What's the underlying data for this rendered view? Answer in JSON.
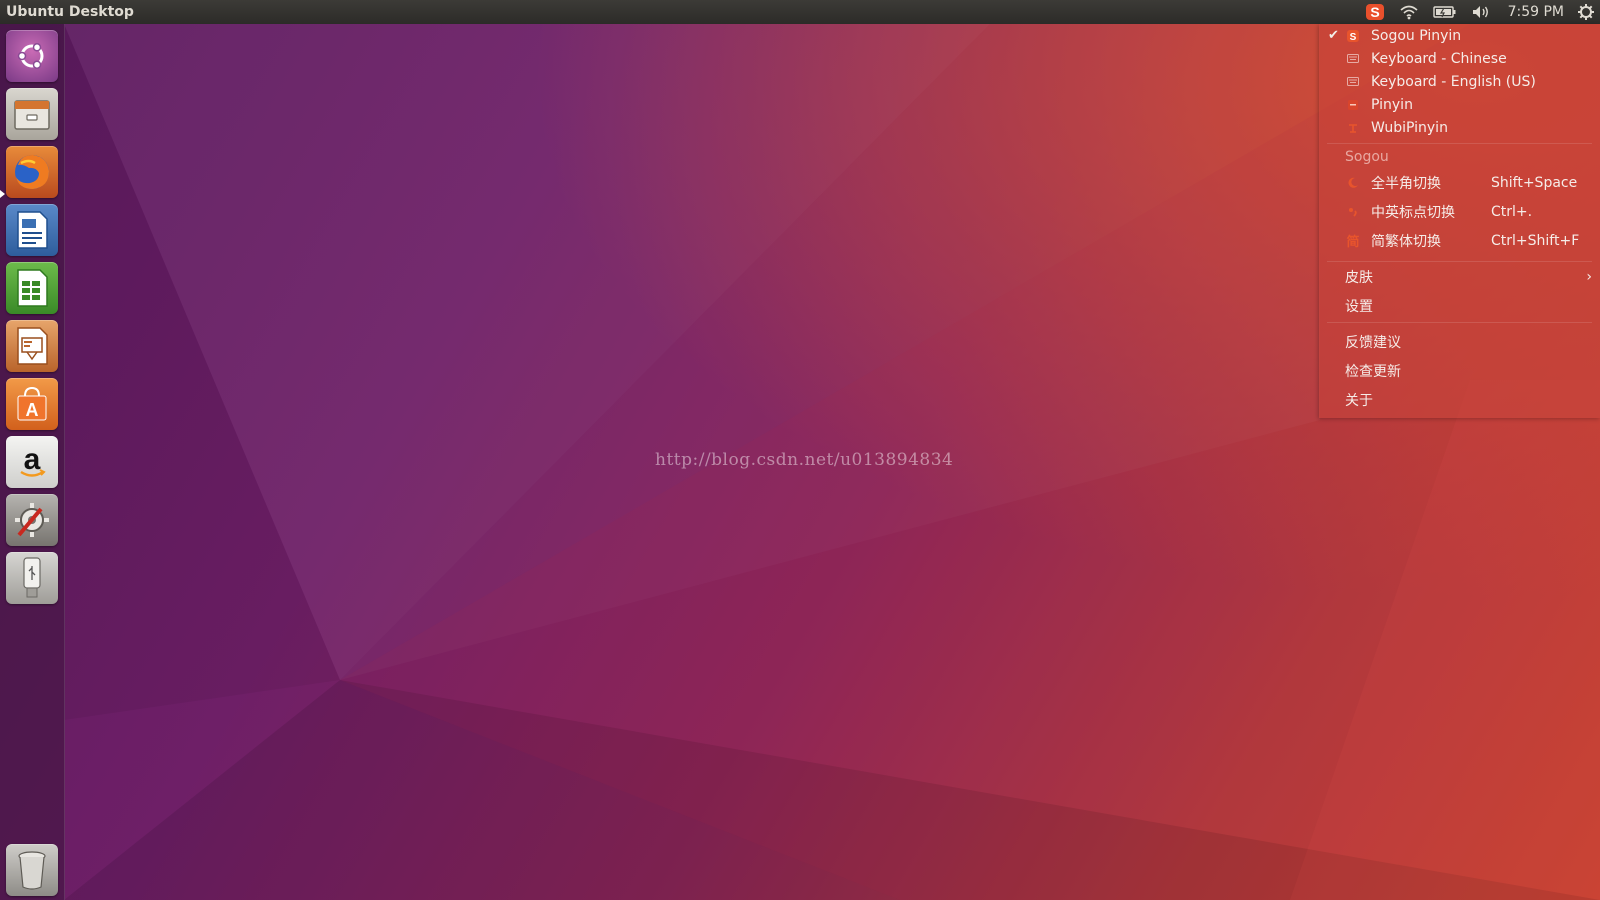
{
  "top_panel": {
    "title": "Ubuntu Desktop",
    "clock": "7:59 PM",
    "indicators": [
      "sogou-icon",
      "wifi-icon",
      "battery-icon",
      "volume-icon",
      "gear-icon"
    ]
  },
  "launcher": {
    "items": [
      {
        "name": "ubuntu-dash-icon"
      },
      {
        "name": "files-icon"
      },
      {
        "name": "firefox-icon"
      },
      {
        "name": "writer-icon"
      },
      {
        "name": "calc-icon"
      },
      {
        "name": "impress-icon"
      },
      {
        "name": "software-center-icon"
      },
      {
        "name": "amazon-icon"
      },
      {
        "name": "system-settings-icon"
      },
      {
        "name": "usb-drive-icon"
      },
      {
        "name": "trash-icon"
      }
    ]
  },
  "watermark": "http://blog.csdn.net/u013894834",
  "im_menu": {
    "input_methods": [
      {
        "label": "Sogou Pinyin",
        "checked": true,
        "icon": "sogou-icon"
      },
      {
        "label": "Keyboard - Chinese",
        "checked": false,
        "icon": "keyboard-icon"
      },
      {
        "label": "Keyboard - English (US)",
        "checked": false,
        "icon": "keyboard-icon"
      },
      {
        "label": "Pinyin",
        "checked": false,
        "icon": "pinyin-icon"
      },
      {
        "label": "WubiPinyin",
        "checked": false,
        "icon": "wubi-icon"
      }
    ],
    "section_header": "Sogou",
    "actions": [
      {
        "label": "全半角切换",
        "accel": "Shift+Space",
        "icon": "moon-icon"
      },
      {
        "label": "中英标点切换",
        "accel": "Ctrl+.",
        "icon": "punct-icon"
      },
      {
        "label": "简繁体切换",
        "accel": "Ctrl+Shift+F",
        "icon": "jian-icon",
        "icon_text": "简"
      }
    ],
    "skin_label": "皮肤",
    "settings_label": "设置",
    "feedback_label": "反馈建议",
    "check_update_label": "检查更新",
    "about_label": "关于",
    "colors": {
      "check": "#f2efe9",
      "accent": "#e8542c"
    }
  }
}
